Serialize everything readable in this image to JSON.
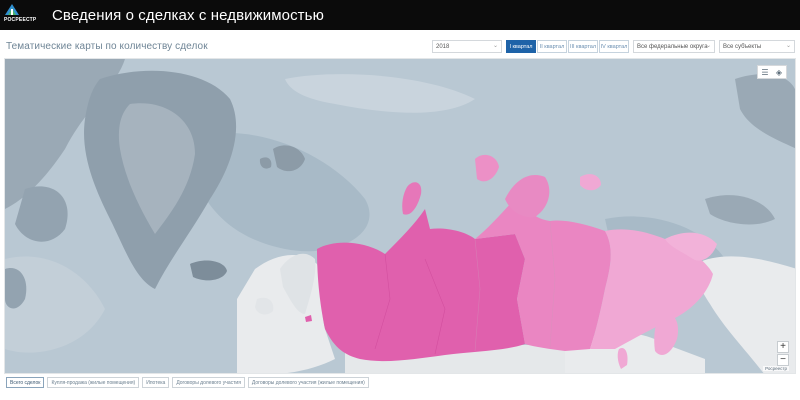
{
  "header": {
    "logo_text": "РОСРЕЕСТР",
    "title": "Сведения о сделках с недвижимостью"
  },
  "toolbar": {
    "page_title": "Тематические карты по количеству сделок",
    "year": "2018",
    "quarters": [
      {
        "label": "I квартал",
        "active": true
      },
      {
        "label": "II квартал",
        "active": false
      },
      {
        "label": "III квартал",
        "active": false
      },
      {
        "label": "IV квартал",
        "active": false
      }
    ],
    "district_select": "Все федеральные округа",
    "subject_select": "Все субъекты"
  },
  "map": {
    "colors": {
      "ocean": "#b9c8d3",
      "land": "#9aa9b5",
      "foreign_land": "#e9ebed",
      "russia_dark": "#e060ad",
      "russia_mid": "#ea86c2",
      "russia_light": "#f0a8d4",
      "ice": "#d7dee4"
    },
    "zoom_in": "+",
    "zoom_out": "−",
    "attribution": "Росреестр"
  },
  "tabs": [
    {
      "label": "Всего сделок",
      "active": true
    },
    {
      "label": "Купля-продажа (жилые помещения)",
      "active": false
    },
    {
      "label": "Ипотека",
      "active": false
    },
    {
      "label": "Договоры долевого участия",
      "active": false
    },
    {
      "label": "Договоры долевого участия (жилые помещения)",
      "active": false
    }
  ]
}
